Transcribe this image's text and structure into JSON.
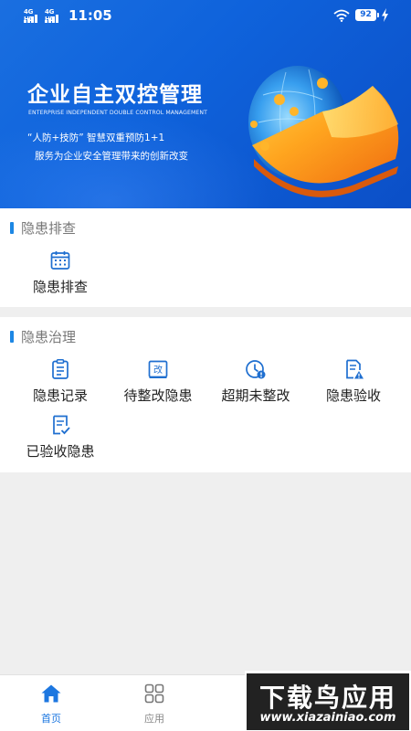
{
  "status_bar": {
    "signal1_label": "4G HD",
    "signal2_label": "4G HD",
    "time": "11:05",
    "battery": "92"
  },
  "banner": {
    "title": "企业自主双控管理",
    "subtitle": "ENTERPRISE INDEPENDENT DOUBLE CONTROL MANAGEMENT",
    "line1": "“人防+技防”  智慧双重预防1+1",
    "line2": "服务为企业安全管理带来的创新改变"
  },
  "sections": {
    "inspection": {
      "title": "隐患排查",
      "items": [
        {
          "label": "隐患排查",
          "icon": "calendar-icon"
        }
      ]
    },
    "governance": {
      "title": "隐患治理",
      "items": [
        {
          "label": "隐患记录",
          "icon": "clipboard-icon"
        },
        {
          "label": "待整改隐患",
          "icon": "edit-box-icon"
        },
        {
          "label": "超期未整改",
          "icon": "clock-alert-icon"
        },
        {
          "label": "隐患验收",
          "icon": "document-warning-icon"
        },
        {
          "label": "已验收隐患",
          "icon": "document-check-icon"
        }
      ]
    }
  },
  "tabbar": {
    "home_label": "首页",
    "apps_label": "应用"
  },
  "watermark": {
    "main": "下载鸟应用",
    "url": "www.xiazainiao.com"
  },
  "colors": {
    "accent": "#1d87e4",
    "banner": "#1566dd",
    "tab_active": "#1d77e0"
  }
}
